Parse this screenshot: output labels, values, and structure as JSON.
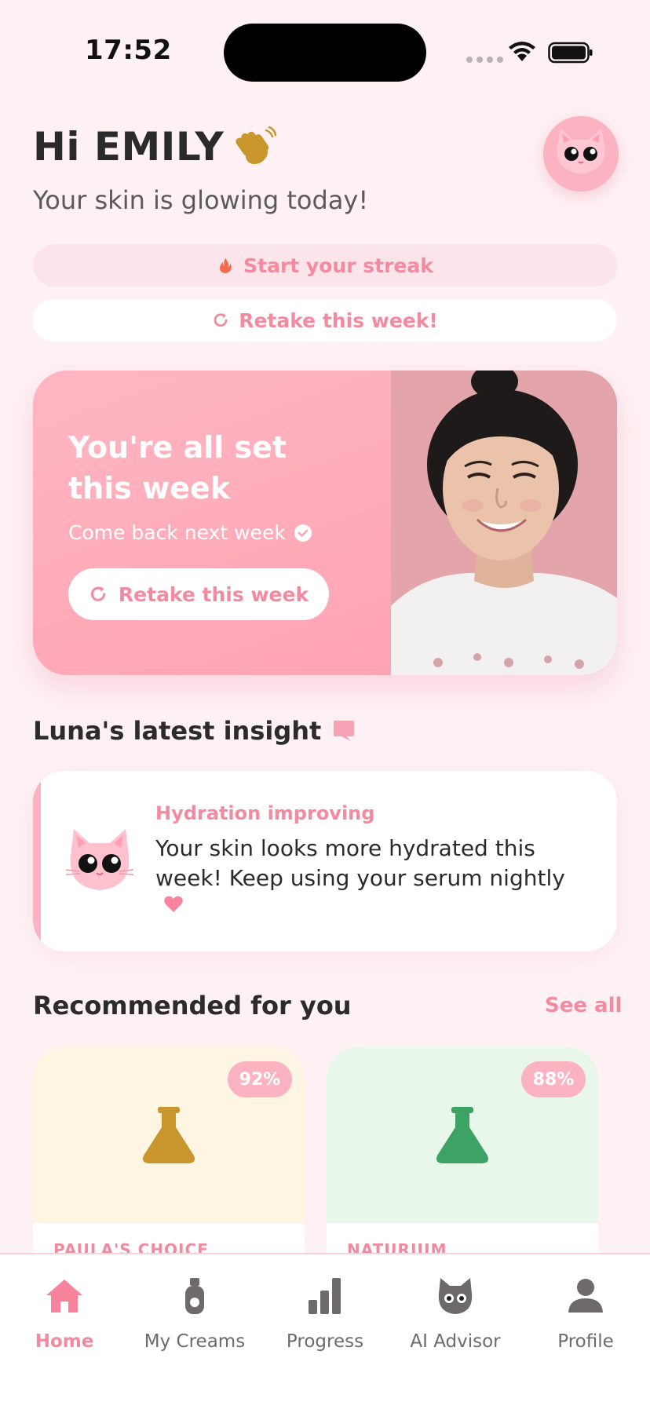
{
  "status_bar": {
    "time": "17:52"
  },
  "header": {
    "greeting": "Hi EMILY",
    "subtitle": "Your skin is glowing today!"
  },
  "pills": {
    "streak_label": "Start your streak",
    "retake_label": "Retake this week!"
  },
  "hero": {
    "title": "You're all set this week",
    "subtitle": "Come back next week",
    "button_label": "Retake this week"
  },
  "insight": {
    "section_title": "Luna's latest insight",
    "label": "Hydration improving",
    "text": "Your skin looks more hydrated this week! Keep using your serum nightly"
  },
  "recommended": {
    "section_title": "Recommended for you",
    "see_all": "See all",
    "products": [
      {
        "match": "92%",
        "brand": "PAULA'S CHOICE",
        "color": "#c9962e"
      },
      {
        "match": "88%",
        "brand": "NATURIUM",
        "color": "#3da364"
      }
    ]
  },
  "nav": {
    "items": [
      {
        "label": "Home",
        "icon": "home-icon",
        "active": true
      },
      {
        "label": "My Creams",
        "icon": "cream-bottle-icon"
      },
      {
        "label": "Progress",
        "icon": "bar-chart-icon"
      },
      {
        "label": "AI Advisor",
        "icon": "cat-advisor-icon"
      },
      {
        "label": "Profile",
        "icon": "person-icon"
      }
    ]
  },
  "colors": {
    "accent": "#f38aa0",
    "pink_light": "#fbb3c2",
    "background": "#fdf1f4"
  }
}
